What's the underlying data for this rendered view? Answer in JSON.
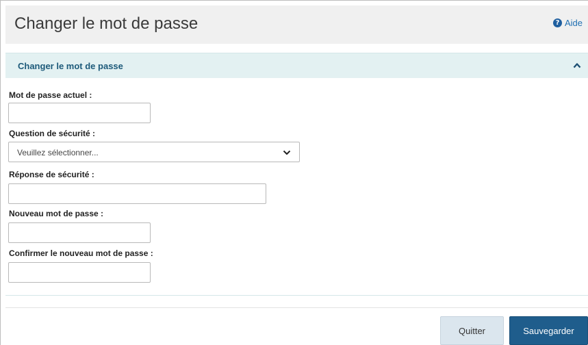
{
  "header": {
    "title": "Changer le mot de passe",
    "help_label": "Aide"
  },
  "section": {
    "title": "Changer le mot de passe"
  },
  "form": {
    "current_password_label": "Mot de passe actuel :",
    "security_question_label": "Question de sécurité :",
    "security_question_value": "Veuillez sélectionner...",
    "security_answer_label": "Réponse de sécurité :",
    "new_password_label": "Nouveau mot de passe :",
    "confirm_password_label": "Confirmer le nouveau mot de passe :"
  },
  "actions": {
    "quit_label": "Quitter",
    "save_label": "Sauvegarder"
  },
  "colors": {
    "header_bg": "#f0f0f0",
    "section_bg": "#e3f1f2",
    "accent": "#1f5d8c",
    "link": "#1f6fb2"
  }
}
